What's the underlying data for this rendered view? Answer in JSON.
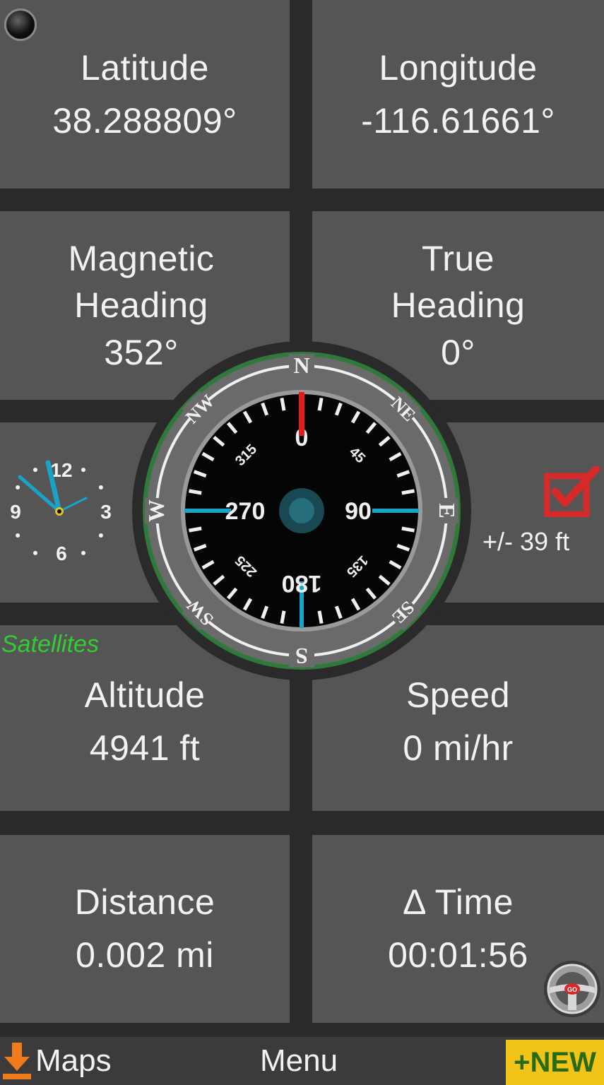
{
  "tiles": {
    "latitude": {
      "label": "Latitude",
      "value": "38.288809°"
    },
    "longitude": {
      "label": "Longitude",
      "value": "-116.61661°"
    },
    "magnetic_heading": {
      "label1": "Magnetic",
      "label2": "Heading",
      "value": "352°"
    },
    "true_heading": {
      "label1": "True",
      "label2": "Heading",
      "value": "0°"
    },
    "altitude": {
      "label": "Altitude",
      "value": "4941 ft"
    },
    "speed": {
      "label": "Speed",
      "value": "0 mi/hr"
    },
    "distance": {
      "label": "Distance",
      "value": "0.002 mi"
    },
    "time": {
      "label": "Δ Time",
      "value": "00:01:56"
    }
  },
  "satellites_label": "Satellites",
  "accuracy": "+/- 39 ft",
  "compass": {
    "cardinals": [
      "N",
      "NE",
      "E",
      "SE",
      "S",
      "SW",
      "W",
      "NW"
    ],
    "degree_labels": [
      "0",
      "45",
      "90",
      "135",
      "180",
      "225",
      "270",
      "315"
    ]
  },
  "clock": {
    "numerals": [
      "12",
      "3",
      "6",
      "9"
    ]
  },
  "bottom_bar": {
    "maps_label": "Maps",
    "menu_label": "Menu",
    "new_label": "+NEW"
  },
  "colors": {
    "tile": "#555555",
    "background": "#2a2a2a",
    "north_needle": "#e01c1c",
    "tick_blue": "#1aa3c8",
    "tick_yellow": "#e6d21a",
    "satellites_green": "#32cd32",
    "new_badge": "#f2c418",
    "checkbox_red": "#d42a2a"
  },
  "icons": [
    "gps-status-icon",
    "download-icon",
    "checkbox-icon",
    "steering-wheel-icon"
  ]
}
